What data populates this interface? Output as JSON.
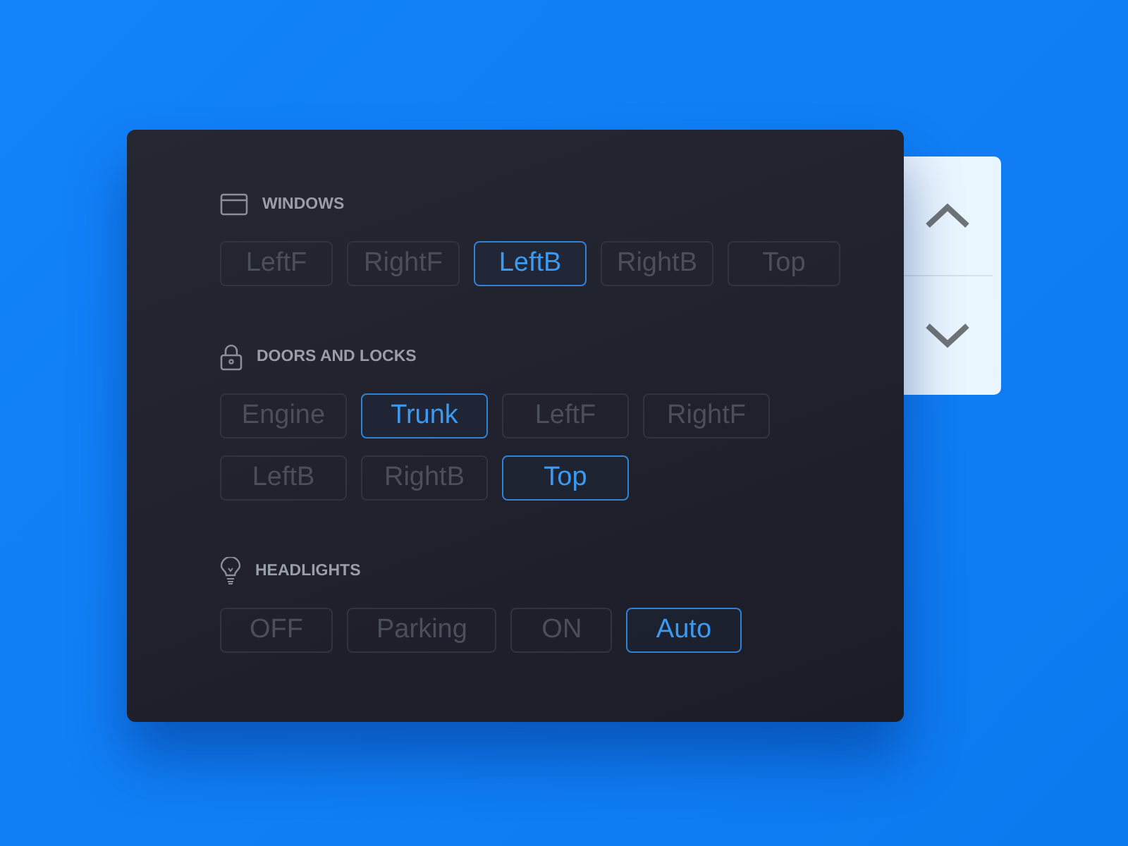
{
  "sections": [
    {
      "title": "WINDOWS",
      "options": [
        {
          "label": "LeftF",
          "selected": false
        },
        {
          "label": "RightF",
          "selected": false
        },
        {
          "label": "LeftB",
          "selected": true
        },
        {
          "label": "RightB",
          "selected": false
        },
        {
          "label": "Top",
          "selected": false
        }
      ]
    },
    {
      "title": "DOORS AND LOCKS",
      "options": [
        {
          "label": "Engine",
          "selected": false
        },
        {
          "label": "Trunk",
          "selected": true
        },
        {
          "label": "LeftF",
          "selected": false
        },
        {
          "label": "RightF",
          "selected": false
        },
        {
          "label": "LeftB",
          "selected": false
        },
        {
          "label": "RightB",
          "selected": false
        },
        {
          "label": "Top",
          "selected": true
        }
      ]
    },
    {
      "title": "HEADLIGHTS",
      "options": [
        {
          "label": "OFF",
          "selected": false
        },
        {
          "label": "Parking",
          "selected": false
        },
        {
          "label": "ON",
          "selected": false
        },
        {
          "label": "Auto",
          "selected": true
        }
      ]
    }
  ]
}
